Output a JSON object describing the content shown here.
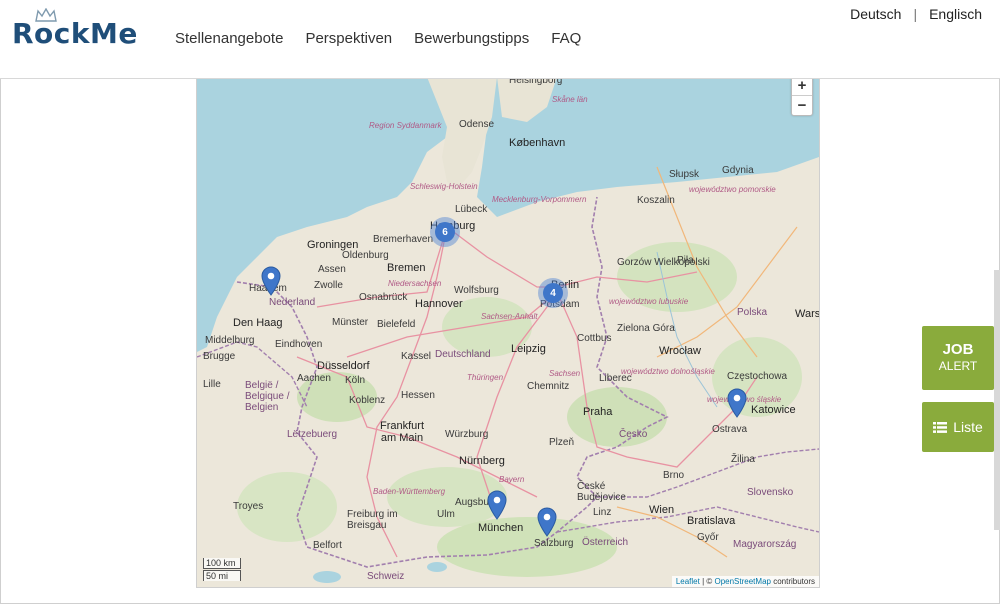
{
  "brand": {
    "logo_text": "RockMe"
  },
  "nav": {
    "items": [
      "Stellenangebote",
      "Perspektiven",
      "Bewerbungstipps",
      "FAQ"
    ]
  },
  "lang": {
    "de": "Deutsch",
    "sep": "|",
    "en": "Englisch"
  },
  "map": {
    "zoom_in": "+",
    "zoom_out": "−",
    "clusters": [
      "6",
      "4"
    ],
    "cities": {
      "koebenhavn": "København",
      "helsingborg": "Helsingborg",
      "odense": "Odense",
      "gdynia": "Gdynia",
      "slupsk": "Słupsk",
      "koszalin": "Koszalin",
      "lubeck": "Lübeck",
      "hamburg": "Hamburg",
      "bremerhaven": "Bremerhaven",
      "groningen": "Groningen",
      "oldenburg": "Oldenburg",
      "bremen": "Bremen",
      "assen": "Assen",
      "zwolle": "Zwolle",
      "haarlem": "Haarlem",
      "nederland": "Nederland",
      "den_haag": "Den Haag",
      "osnabruck": "Osnabrück",
      "hannover": "Hannover",
      "wolfsburg": "Wolfsburg",
      "berlin": "Berlin",
      "potsdam": "Potsdam",
      "gorzow": "Gorzów Wielkopolski",
      "pila": "Piła",
      "munster": "Münster",
      "bielefeld": "Bielefeld",
      "eindhoven": "Eindhoven",
      "middelburg": "Middelburg",
      "brugge": "Brugge",
      "kassel": "Kassel",
      "deutschland": "Deutschland",
      "leipzig": "Leipzig",
      "cottbus": "Cottbus",
      "zielona": "Zielona Góra",
      "polska": "Polska",
      "warszawa": "Warsz",
      "dusseldorf": "Düsseldorf",
      "aachen": "Aachen",
      "koln": "Köln",
      "lille": "Lille",
      "belgie": "België / Belgique / Belgien",
      "chemnitz": "Chemnitz",
      "liberec": "Liberec",
      "wroclaw": "Wrocław",
      "czestochowa": "Częstochowa",
      "katowice": "Katowice",
      "ostrava": "Ostrava",
      "hessen": "Hessen",
      "koblenz": "Koblenz",
      "frankfurt": "Frankfurt am Main",
      "wurzburg": "Würzburg",
      "praha": "Praha",
      "cesko": "Česko",
      "plzen": "Plzeň",
      "letzebuerg": "Lëtzebuerg",
      "nurnberg": "Nürnberg",
      "zilina": "Žilina",
      "augsburg": "Augsburg",
      "munchen": "München",
      "salzburg": "Salzburg",
      "osterreich": "Österreich",
      "wien": "Wien",
      "bratislava": "Bratislava",
      "slovensko": "Slovensko",
      "brno": "Brno",
      "freiburg": "Freiburg im Breisgau",
      "ulm": "Ulm",
      "troyes": "Troyes",
      "belfort": "Belfort",
      "schweiz": "Schweiz",
      "budejovice": "České Budějovice",
      "linz": "Linz",
      "gyor": "Győr",
      "magyarorszag": "Magyarország"
    },
    "regions": {
      "schleswig": "Schleswig-Holstein",
      "mecklenburg": "Mecklenburg-Vorpommern",
      "niedersachsen": "Niedersachsen",
      "sachsen_anhalt": "Sachsen-Anhalt",
      "thuringen": "Thüringen",
      "sachsen": "Sachsen",
      "bayern": "Bayern",
      "baden": "Baden-Württemberg",
      "syddanmark": "Region Syddanmark",
      "skane": "Skåne län",
      "pomorskie": "województwo pomorskie",
      "lubuskie": "województwo lubuskie",
      "dolnoslaskie": "województwo dolnośląskie",
      "slaskie": "województwo śląskie"
    },
    "scale": {
      "km": "100 km",
      "mi": "50 mi"
    },
    "attribution": {
      "leaflet": "Leaflet",
      "sep": " | © ",
      "osm": "OpenStreetMap",
      "rest": " contributors"
    }
  },
  "side": {
    "job_line1": "JOB",
    "job_line2": "ALERT",
    "liste": "Liste"
  },
  "colors": {
    "brand_blue": "#1f4e79",
    "accent_green": "#8aab3c",
    "marker_blue": "#3f76c9",
    "sea": "#aad3df",
    "land": "#ece7da"
  }
}
